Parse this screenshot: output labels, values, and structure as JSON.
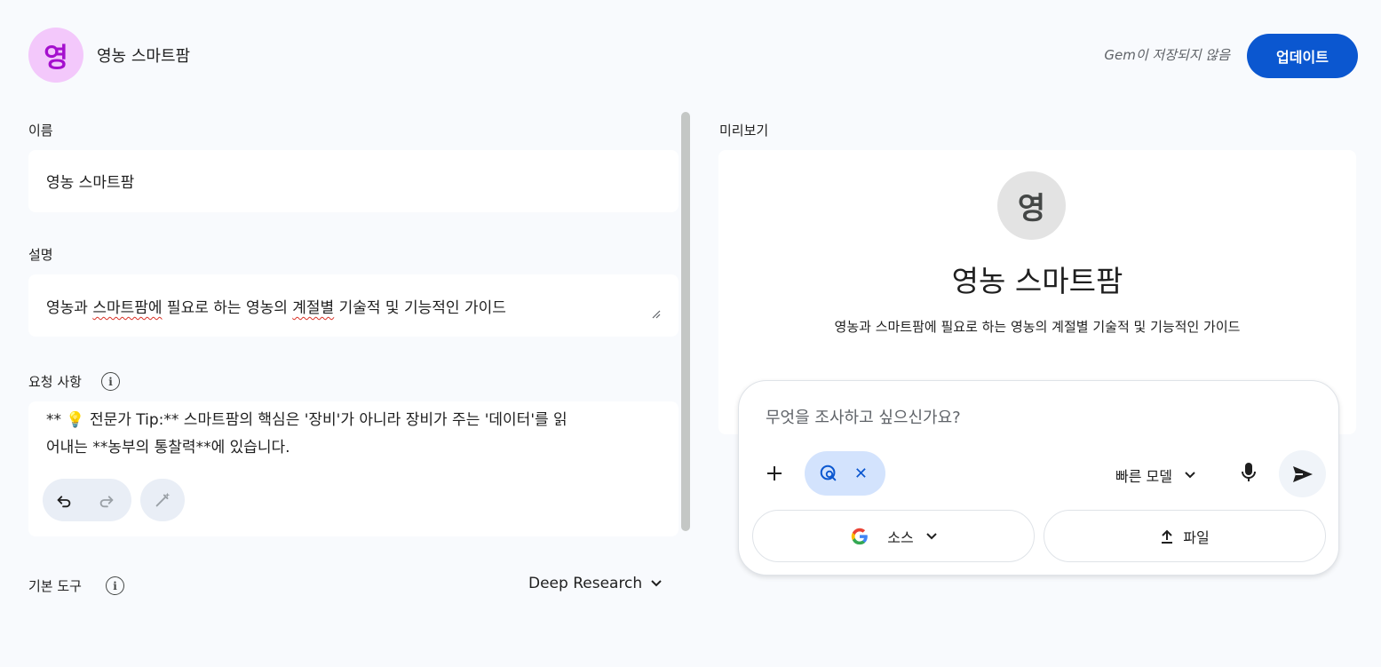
{
  "header": {
    "avatar_letter": "영",
    "title": "영농 스마트팜",
    "save_status": "Gem이 저장되지 않음",
    "update_label": "업데이트"
  },
  "editor": {
    "name_label": "이름",
    "name_value": "영농 스마트팜",
    "description_label": "설명",
    "description_parts": [
      "영농과 ",
      "스마트팜에",
      " 필요로 하는 영농의 ",
      "계절별",
      " 기술적 및 기능적인 가이드"
    ],
    "instructions_label": "요청 사항",
    "instructions_line1": "** 💡 전문가 Tip:** 스마트팜의 핵심은 '장비'가 아니라 장비가 주는 '데이터'를 읽",
    "instructions_line2": "어내는 **농부의 통찰력**에 있습니다.",
    "tools_label": "기본 도구",
    "tools_value": "Deep Research"
  },
  "preview": {
    "label": "미리보기",
    "avatar_letter": "영",
    "title": "영농 스마트팜",
    "description": "영농과 스마트팜에 필요로 하는 영농의 계절별 기술적 및 기능적인 가이드",
    "input_placeholder": "무엇을 조사하고 싶으신가요?",
    "model_label": "빠른 모델",
    "sources_label": "소스",
    "file_label": "파일"
  },
  "colors": {
    "accent": "#0b57d0",
    "avatar_bg": "#f3c8fb",
    "avatar_fg": "#a50fce",
    "chip_bg": "#d3e3fd"
  },
  "icons": {
    "undo": "undo-icon",
    "redo": "redo-icon",
    "magic": "magic-wand-icon",
    "info": "info-icon",
    "plus": "plus-icon",
    "research": "deep-research-icon",
    "mic": "mic-icon",
    "send": "send-icon",
    "google": "google-icon",
    "upload": "upload-icon"
  }
}
